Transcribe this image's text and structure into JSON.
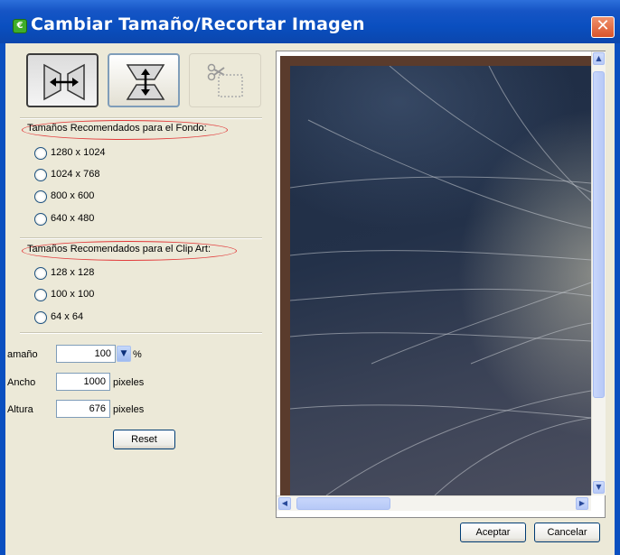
{
  "window": {
    "title": "Cambiar Tamaño/Recortar Imagen",
    "close_label": "✕",
    "app_icon_label": "€"
  },
  "toolbar": {
    "buttons": [
      {
        "name": "fit-width",
        "icon": "horizontal-resize-icon"
      },
      {
        "name": "fit-height",
        "icon": "vertical-resize-icon"
      },
      {
        "name": "crop",
        "icon": "crop-icon"
      }
    ]
  },
  "background_sizes": {
    "label": "Tamaños Recomendados para el Fondo:",
    "options": [
      "1280 x 1024",
      "1024 x 768",
      "800 x 600",
      "640 x 480"
    ]
  },
  "clipart_sizes": {
    "label": "Tamaños Recomendados para el Clip Art:",
    "options": [
      "128 x 128",
      "100 x 100",
      "64 x 64"
    ]
  },
  "size_field": {
    "label": "amaño",
    "value": "100",
    "unit": "%"
  },
  "width_field": {
    "label": "Ancho",
    "value": "1000",
    "unit": "pixeles"
  },
  "height_field": {
    "label": "Altura",
    "value": "676",
    "unit": "pixeles"
  },
  "reset_label": "Reset",
  "ok_label": "Aceptar",
  "cancel_label": "Cancelar",
  "scrollbars": {
    "up": "▲",
    "down": "▼",
    "left": "◀",
    "right": "▶"
  },
  "dropdown_arrow": "▼",
  "colors": {
    "title_bar": "#0a4fc0",
    "ellipse": "#e23a3a",
    "dialog_bg": "#ece9d8"
  }
}
